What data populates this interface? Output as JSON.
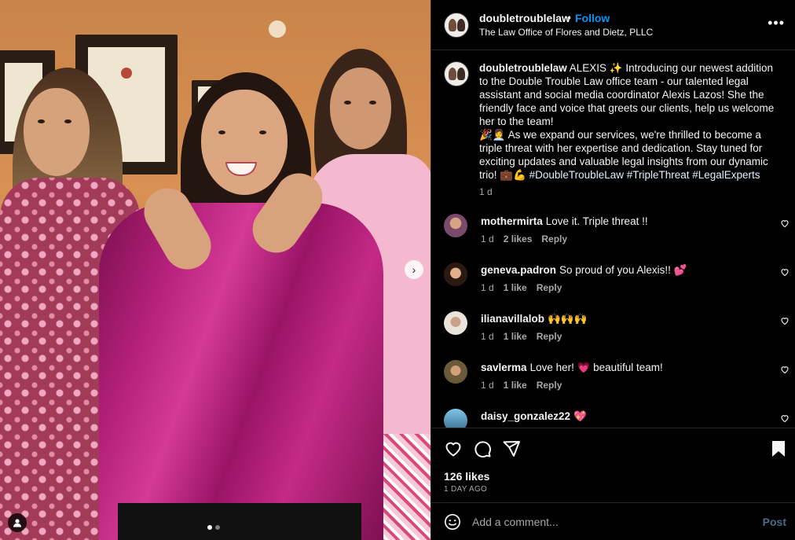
{
  "post": {
    "username": "doubletroublelaw",
    "follow_label": "Follow",
    "separator": "•",
    "location": "The Law Office of Flores and Dietz, PLLC",
    "more_label": "•••"
  },
  "caption": {
    "username": "doubletroublelaw",
    "text_1": "ALEXIS ✨ Introducing our newest addition to the Double Trouble Law office team - our talented legal assistant and social media coordinator Alexis Lazos! She the friendly face and voice that greets our clients, help us welcome her to the team!",
    "text_2": "🎉👩‍💼 As we expand our services, we're thrilled to become a triple threat with her expertise and dedication. Stay tuned for exciting updates and valuable legal insights from our dynamic trio! 💼💪",
    "hashtags": "#DoubleTroubleLaw #TripleThreat #LegalExperts",
    "time": "1 d"
  },
  "comments": [
    {
      "user": "mothermirta",
      "text": "Love it. Triple threat !!",
      "time": "1 d",
      "likes": "2 likes",
      "reply": "Reply",
      "avatar_color": "#7a4a6a"
    },
    {
      "user": "geneva.padron",
      "text": "So proud of you Alexis!! 💕",
      "time": "1 d",
      "likes": "1 like",
      "reply": "Reply",
      "avatar_color": "#5a3a2a"
    },
    {
      "user": "ilianavillalob",
      "text": "🙌🙌🙌",
      "time": "1 d",
      "likes": "1 like",
      "reply": "Reply",
      "avatar_color": "#e9e3dc"
    },
    {
      "user": "savlerma",
      "text": "Love her! 💗 beautiful team!",
      "time": "1 d",
      "likes": "1 like",
      "reply": "Reply",
      "avatar_color": "#6b5a3a"
    },
    {
      "user": "daisy_gonzalez22",
      "text": "💖",
      "time": "",
      "likes": "",
      "reply": "",
      "avatar_color": "#3a6a8a"
    }
  ],
  "engagement": {
    "likes": "126 likes",
    "posted": "1 DAY AGO"
  },
  "composer": {
    "placeholder": "Add a comment...",
    "post_label": "Post"
  },
  "carousel": {
    "next_label": "›",
    "slides": 2,
    "active_slide": 1
  },
  "colors": {
    "follow_blue": "#0095f6",
    "background": "#000000",
    "muted": "#a8a8a8"
  }
}
